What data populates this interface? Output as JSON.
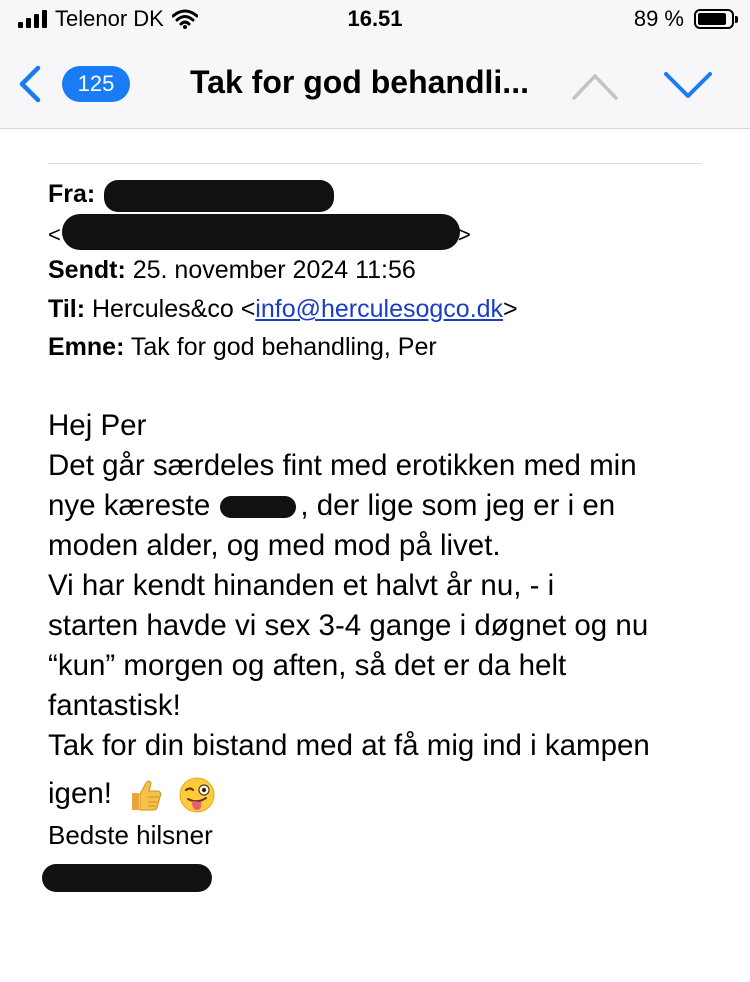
{
  "status_bar": {
    "carrier": "Telenor DK",
    "time": "16.51",
    "battery": "89 %",
    "battery_level": 0.89
  },
  "nav": {
    "unread_count": "125",
    "title": "Tak for god behandli...",
    "icons": [
      "chevron-left-icon",
      "chevron-up-icon",
      "chevron-down-icon"
    ]
  },
  "email": {
    "from_label": "Fra:",
    "sent_label": "Sendt:",
    "sent_value": "25. november 2024 11:56",
    "to_label": "Til:",
    "to_name": "Hercules&co",
    "to_lt": "<",
    "to_email": "info@herculesogco.dk",
    "to_gt": ">",
    "subject_label": "Emne:",
    "subject_value": "Tak for god behandling, Per",
    "greeting": "Hej Per",
    "line1": "Det går særdeles fint med erotikken med min",
    "line2a": "nye kæreste",
    "line2b": ", der lige som jeg er i en",
    "line3": "moden alder, og med mod på livet.",
    "line4": "Vi har kendt hinanden et halvt år nu, - i",
    "line5": "starten havde vi sex 3-4 gange i døgnet og nu",
    "line6": "“kun” morgen og aften, så det er da helt",
    "line7": "fantastisk!",
    "line8": "Tak for din bistand med at få mig ind i kampen",
    "line9": "igen!",
    "sign_off": "Bedste hilsner"
  },
  "colors": {
    "accent": "#1a7cf5",
    "link": "#1a3ec0"
  }
}
